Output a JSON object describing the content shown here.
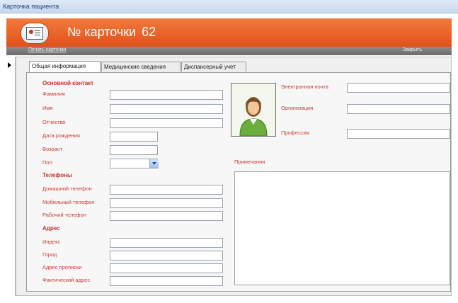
{
  "window": {
    "title": "Карточка пациента"
  },
  "header": {
    "prefix": "№ карточки",
    "card_number": "62"
  },
  "toolbar": {
    "print_label": "Печать карточки",
    "close_label": "Закрыть"
  },
  "tabs": [
    {
      "label": "Общая информация",
      "active": true
    },
    {
      "label": "Медицинские сведения",
      "active": false
    },
    {
      "label": "Диспансерный учет",
      "active": false
    }
  ],
  "main_contact": {
    "section": "Основной контакт",
    "last_name": {
      "label": "Фамилия",
      "value": ""
    },
    "first_name": {
      "label": "Имя",
      "value": ""
    },
    "patronymic": {
      "label": "Отчество",
      "value": ""
    },
    "birth_date": {
      "label": "Дата рождения",
      "value": ""
    },
    "age": {
      "label": "Возраст",
      "value": ""
    },
    "sex": {
      "label": "Пол",
      "value": ""
    }
  },
  "phones": {
    "section": "Телефоны",
    "home": {
      "label": "Домашний телефон",
      "value": ""
    },
    "mobile": {
      "label": "Мобильный телефон",
      "value": ""
    },
    "work": {
      "label": "Рабочий телефон",
      "value": ""
    }
  },
  "address": {
    "section": "Адрес",
    "zip": {
      "label": "Индекс",
      "value": ""
    },
    "city": {
      "label": "Город",
      "value": ""
    },
    "registration": {
      "label": "Адрес прописки",
      "value": ""
    },
    "actual": {
      "label": "Фактический адрес",
      "value": ""
    }
  },
  "extra": {
    "email": {
      "label": "Электронная почта",
      "value": ""
    },
    "organization": {
      "label": "Организация",
      "value": ""
    },
    "profession": {
      "label": "Профессия",
      "value": ""
    }
  },
  "notes": {
    "label": "Примечания",
    "value": ""
  },
  "icons": {
    "header": "patient-card-icon",
    "photo": "person-avatar-icon",
    "record": "record-selector-icon",
    "dropdown": "chevron-down-icon"
  },
  "colors": {
    "header": "#e9622a",
    "label": "#cc3b32",
    "toolbar": "#7a7a7a"
  }
}
